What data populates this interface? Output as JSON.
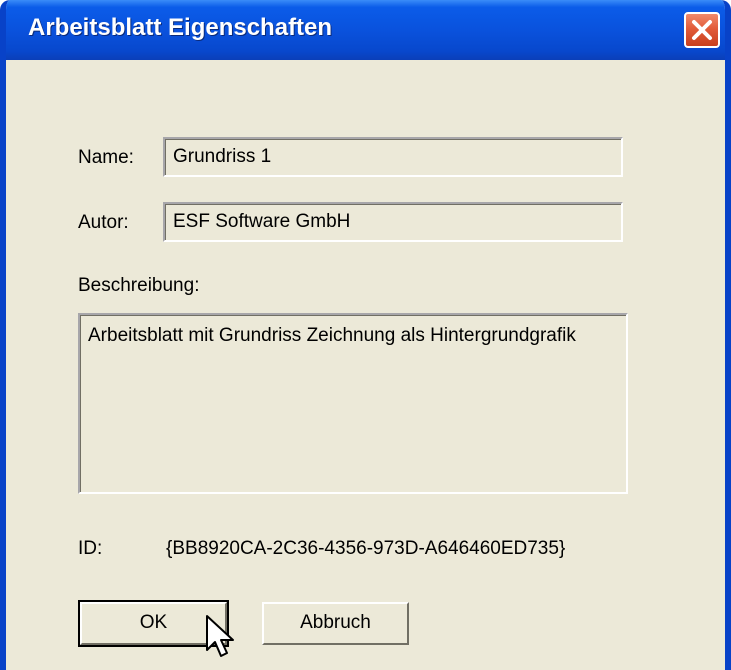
{
  "window": {
    "title": "Arbeitsblatt Eigenschaften"
  },
  "form": {
    "name_label": "Name:",
    "name_value": "Grundriss 1",
    "author_label": "Autor:",
    "author_value": "ESF Software GmbH",
    "description_label": "Beschreibung:",
    "description_value": "Arbeitsblatt mit Grundriss Zeichnung als Hintergrundgrafik",
    "id_label": "ID:",
    "id_value": "{BB8920CA-2C36-4356-973D-A646460ED735}"
  },
  "buttons": {
    "ok_label": "OK",
    "cancel_label": "Abbruch"
  },
  "colors": {
    "titlebar": "#0a52dd",
    "dialog_background": "#ece9d8",
    "close_button": "#e25c3a"
  },
  "icons": {
    "close": "close-icon",
    "cursor": "mouse-pointer-icon"
  }
}
